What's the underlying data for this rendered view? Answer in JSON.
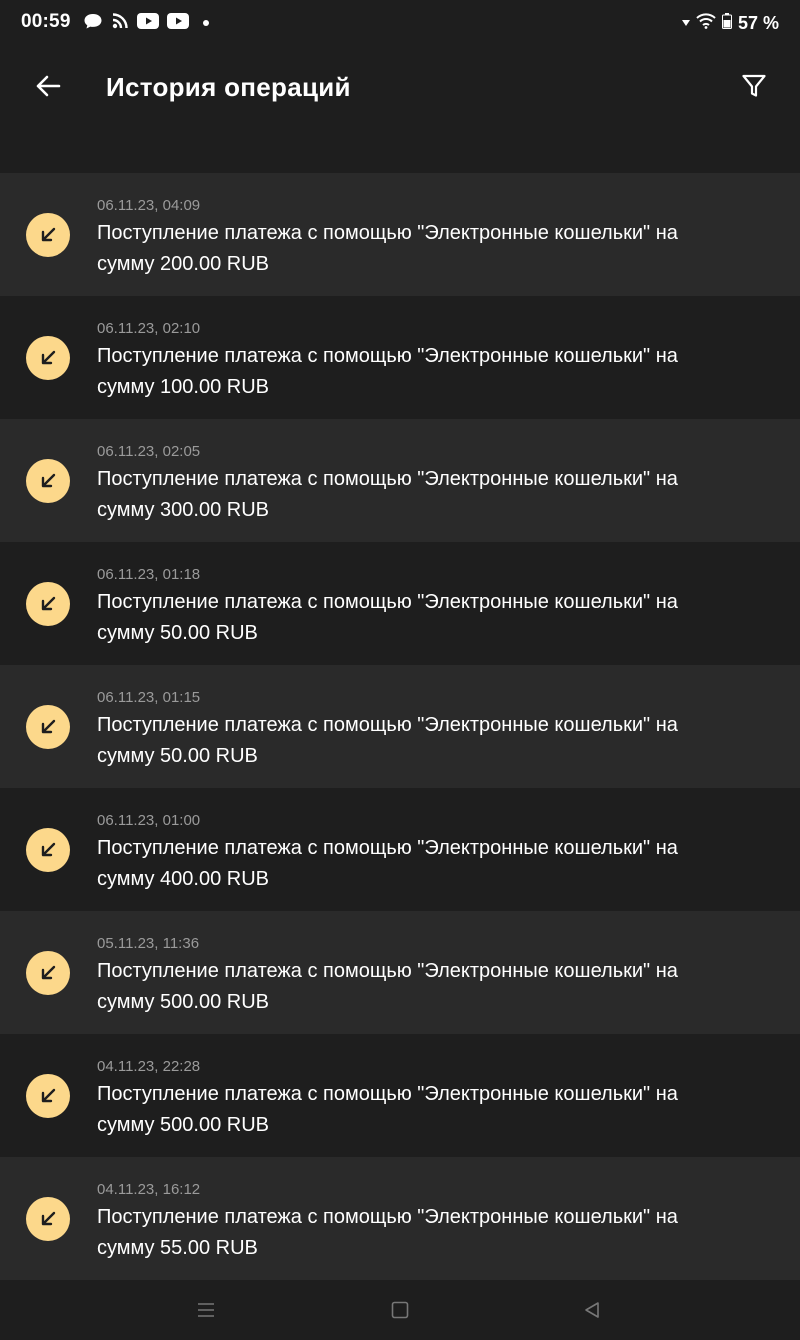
{
  "status_bar": {
    "time": "00:59",
    "icons": [
      "chat-bubble-icon",
      "rss-icon",
      "youtube-icon",
      "youtube-icon",
      "dot-icon"
    ],
    "battery": "57 %"
  },
  "header": {
    "title": "История операций",
    "back_icon": "arrow-left-icon",
    "filter_icon": "filter-icon"
  },
  "colors": {
    "background": "#1e1e1e",
    "row_alt": "#2a2a2a",
    "accent": "#fcd88b",
    "date_text": "#9a9a9a"
  },
  "operations": [
    {
      "date": "06.11.23, 04:09",
      "text": "Поступление платежа с помощью \"Электронные кошельки\" на сумму 200.00 RUB",
      "icon": "incoming-arrow-icon"
    },
    {
      "date": "06.11.23, 02:10",
      "text": "Поступление платежа с помощью \"Электронные кошельки\" на сумму 100.00 RUB",
      "icon": "incoming-arrow-icon"
    },
    {
      "date": "06.11.23, 02:05",
      "text": "Поступление платежа с помощью \"Электронные кошельки\" на сумму 300.00 RUB",
      "icon": "incoming-arrow-icon"
    },
    {
      "date": "06.11.23, 01:18",
      "text": "Поступление платежа с помощью \"Электронные кошельки\" на сумму 50.00 RUB",
      "icon": "incoming-arrow-icon"
    },
    {
      "date": "06.11.23, 01:15",
      "text": "Поступление платежа с помощью \"Электронные кошельки\" на сумму 50.00 RUB",
      "icon": "incoming-arrow-icon"
    },
    {
      "date": "06.11.23, 01:00",
      "text": "Поступление платежа с помощью \"Электронные кошельки\" на сумму 400.00 RUB",
      "icon": "incoming-arrow-icon"
    },
    {
      "date": "05.11.23, 11:36",
      "text": "Поступление платежа с помощью \"Электронные кошельки\" на сумму 500.00 RUB",
      "icon": "incoming-arrow-icon"
    },
    {
      "date": "04.11.23, 22:28",
      "text": "Поступление платежа с помощью \"Электронные кошельки\" на сумму 500.00 RUB",
      "icon": "incoming-arrow-icon"
    },
    {
      "date": "04.11.23, 16:12",
      "text": "Поступление платежа с помощью \"Электронные кошельки\" на сумму 55.00 RUB",
      "icon": "incoming-arrow-icon"
    }
  ],
  "nav_bar": {
    "buttons": [
      "menu-icon",
      "home-square-icon",
      "back-triangle-icon"
    ]
  }
}
